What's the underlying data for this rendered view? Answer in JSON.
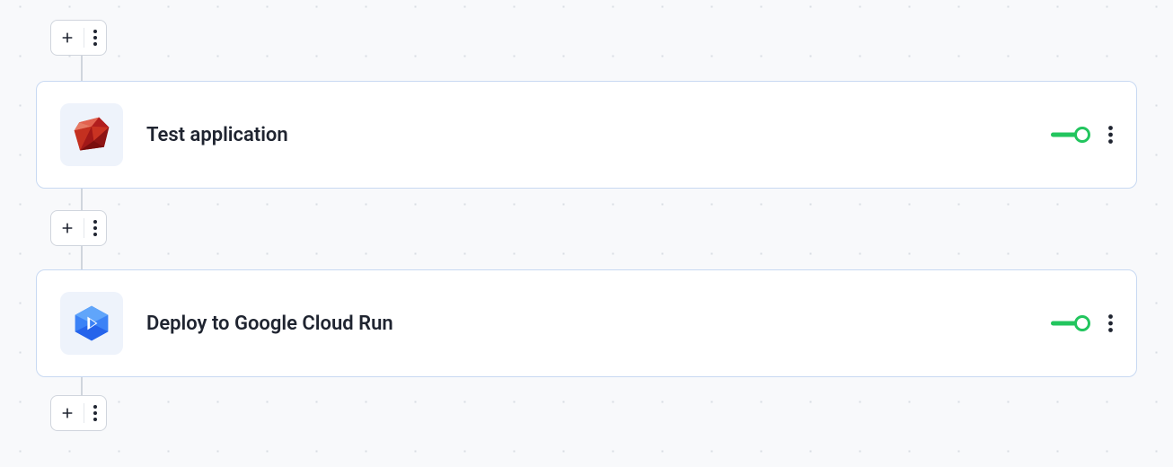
{
  "pipeline": {
    "steps": [
      {
        "icon": "ruby",
        "title": "Test application",
        "enabled": true
      },
      {
        "icon": "google-cloud",
        "title": "Deploy to Google Cloud Run",
        "enabled": true
      }
    ]
  },
  "icons": {
    "plus": "plus",
    "kebab": "more-vertical"
  }
}
